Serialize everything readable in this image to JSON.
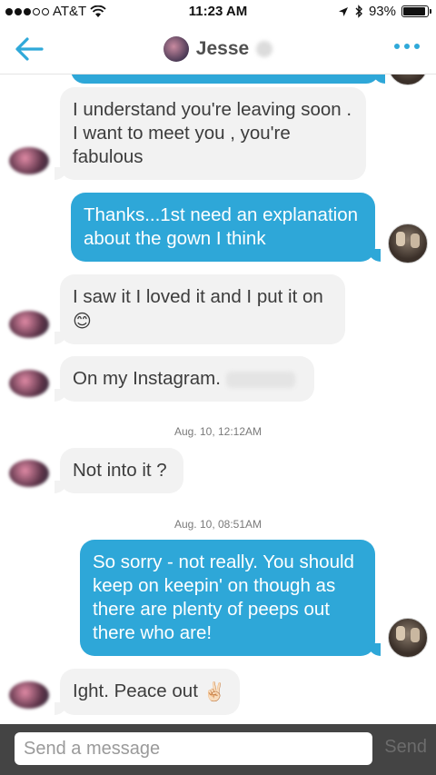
{
  "status_bar": {
    "carrier": "AT&T",
    "time": "11:23 AM",
    "battery": "93%",
    "battery_level": 0.93
  },
  "header": {
    "name": "Jesse"
  },
  "messages": [
    {
      "direction": "in",
      "text": "I understand you're leaving soon . I want to meet you , you're fabulous"
    },
    {
      "direction": "out",
      "text": "Thanks...1st need an explanation about the gown I think"
    },
    {
      "direction": "in",
      "text": "I saw it I loved it and I put it on",
      "emoji": "😊"
    },
    {
      "direction": "in",
      "text": "On my Instagram."
    },
    {
      "timestamp": "Aug. 10, 12:12AM"
    },
    {
      "direction": "in",
      "text": "Not into it ?"
    },
    {
      "timestamp": "Aug. 10, 08:51AM"
    },
    {
      "direction": "out",
      "text": "So sorry - not really. You should keep on keepin' on though as there are plenty of peeps out there who are!"
    },
    {
      "direction": "in",
      "text": "Ight. Peace out",
      "emoji": "✌🏻"
    }
  ],
  "composer": {
    "placeholder": "Send a message",
    "send_label": "Send"
  },
  "colors": {
    "accent": "#2fa9d9",
    "outgoing_bubble": "#2ea7d8",
    "incoming_bubble": "#f2f2f2",
    "composer_bar": "#444444"
  }
}
